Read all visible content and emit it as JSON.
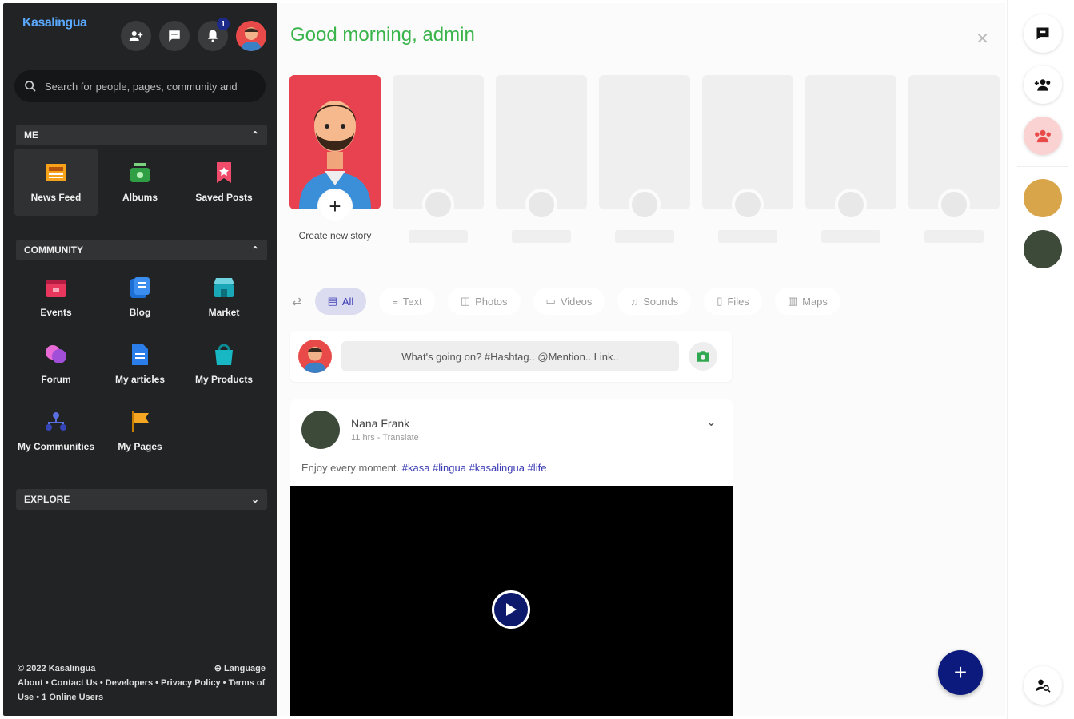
{
  "brand": {
    "logo_text": "Kasalingua"
  },
  "header": {
    "notification_count": "1"
  },
  "search": {
    "placeholder": "Search for people, pages, community and"
  },
  "sections": {
    "me": {
      "title": "ME",
      "items": [
        {
          "label": "News Feed",
          "icon": "newspaper-icon"
        },
        {
          "label": "Albums",
          "icon": "album-icon"
        },
        {
          "label": "Saved Posts",
          "icon": "bookmark-icon"
        }
      ]
    },
    "community": {
      "title": "COMMUNITY",
      "items": [
        {
          "label": "Events",
          "icon": "calendar-icon"
        },
        {
          "label": "Blog",
          "icon": "blog-icon"
        },
        {
          "label": "Market",
          "icon": "store-icon"
        },
        {
          "label": "Forum",
          "icon": "chat-bubbles-icon"
        },
        {
          "label": "My articles",
          "icon": "article-icon"
        },
        {
          "label": "My Products",
          "icon": "product-bag-icon"
        },
        {
          "label": "My Communities",
          "icon": "hierarchy-icon"
        },
        {
          "label": "My Pages",
          "icon": "flag-icon"
        }
      ]
    },
    "explore": {
      "title": "EXPLORE"
    }
  },
  "footer": {
    "copyright": "© 2022 Kasalingua",
    "language": "Language",
    "links": "About • Contact Us • Developers • Privacy Policy • Terms of Use • 1 Online Users"
  },
  "main": {
    "greeting": "Good morning, admin",
    "create_story_label": "Create new story",
    "filters": [
      {
        "label": "All",
        "active": true
      },
      {
        "label": "Text"
      },
      {
        "label": "Photos"
      },
      {
        "label": "Videos"
      },
      {
        "label": "Sounds"
      },
      {
        "label": "Files"
      },
      {
        "label": "Maps"
      }
    ],
    "composer_placeholder": "What's going on? #Hashtag.. @Mention.. Link..",
    "post": {
      "author": "Nana Frank",
      "meta": "11 hrs - Translate",
      "text": "Enjoy every moment.",
      "tags": "#kasa #lingua #kasalingua #life"
    }
  },
  "colors": {
    "sidebar_bg": "#222324",
    "greeting": "#38b44a",
    "accent": "#0b1a7c",
    "tag": "#3b3bb5"
  }
}
